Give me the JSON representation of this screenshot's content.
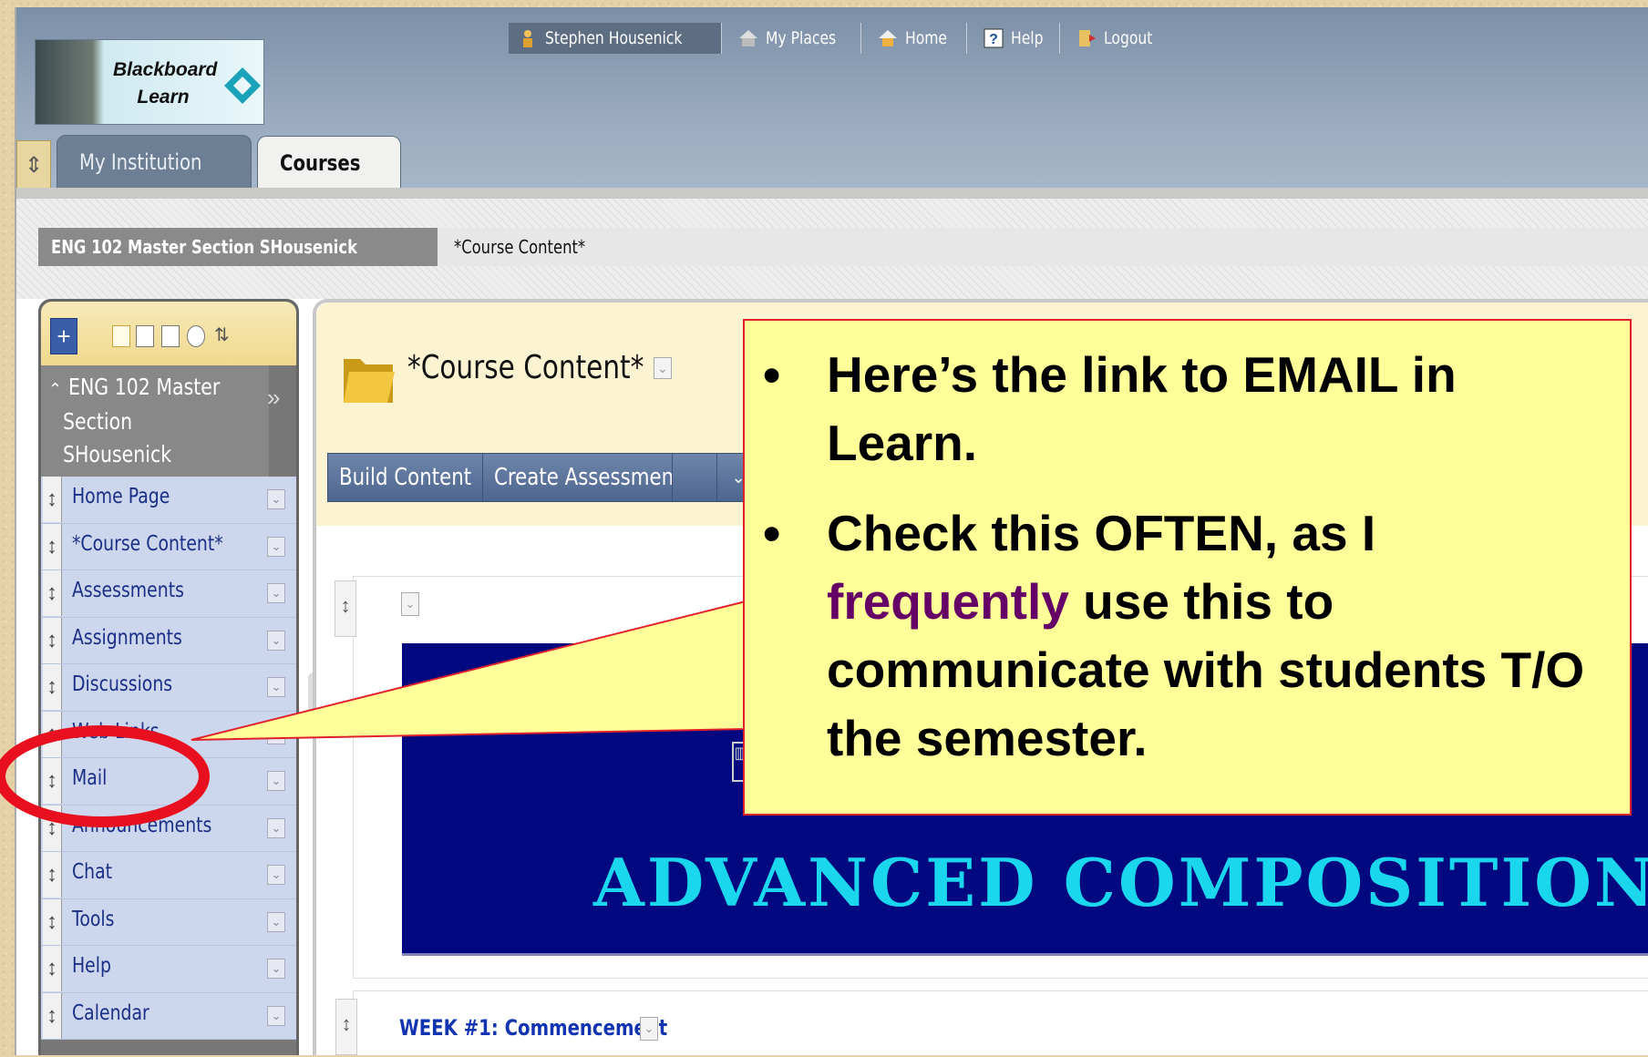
{
  "header": {
    "logo_line1": "Blackboard",
    "logo_line2": "Learn",
    "user": "Stephen Housenick",
    "my_places": "My Places",
    "home": "Home",
    "help": "Help",
    "logout": "Logout"
  },
  "tabs": {
    "my_institution": "My Institution",
    "courses": "Courses"
  },
  "breadcrumb": {
    "course": "ENG 102 Master Section SHousenick",
    "page": "*Course Content*"
  },
  "course_menu": {
    "course_line1": "ENG 102 Master",
    "course_line2": "Section",
    "course_line3": "SHousenick",
    "items": [
      "Home Page",
      "*Course Content*",
      "Assessments",
      "Assignments",
      "Discussions",
      "Web Links",
      "Mail",
      "Announcements",
      "Chat",
      "Tools",
      "Help",
      "Calendar"
    ]
  },
  "content": {
    "title": "*Course Content*",
    "build_content": "Build Content",
    "create_assessment": "Create Assessment",
    "banner_title": "ADVANCED COMPOSITION",
    "week_link": "WEEK #1: Commencement"
  },
  "callout": {
    "bullet1": "Here’s the link to EMAIL in Learn.",
    "bullet2_pre": "Check this OFTEN, as I ",
    "bullet2_highlight": "frequently",
    "bullet2_post": " use this to communicate with students T/O the semester."
  },
  "colors": {
    "highlight_word": "#650067",
    "callout_fill": "#ffff99",
    "annotation_red": "#e8101e",
    "banner_bg": "#000880",
    "banner_text": "#1ad7ee"
  }
}
